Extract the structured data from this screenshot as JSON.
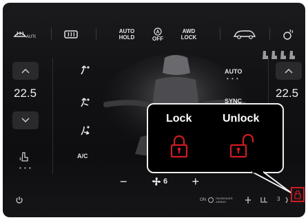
{
  "toolbar": {
    "auto_hold": "AUTO\nHOLD",
    "off": "OFF",
    "awd_lock": "AWD\nLOCK"
  },
  "left": {
    "temperature": "22.5",
    "ac_label": "A/C",
    "dots": "• • •"
  },
  "right": {
    "temperature": "22.5",
    "auto_label": "AUTO",
    "sync_label": "SYNC",
    "dots": "• • •"
  },
  "fan": {
    "minus": "−",
    "plus": "+",
    "level": "6"
  },
  "status": {
    "airbag_on": "ON",
    "airbag_text1": "PASSENGER",
    "airbag_text2": "AIRBAG",
    "seat_label": "3"
  },
  "callout": {
    "lock": "Lock",
    "unlock": "Unlock"
  },
  "colors": {
    "accent_red": "#d11b24",
    "background": "#121214"
  }
}
